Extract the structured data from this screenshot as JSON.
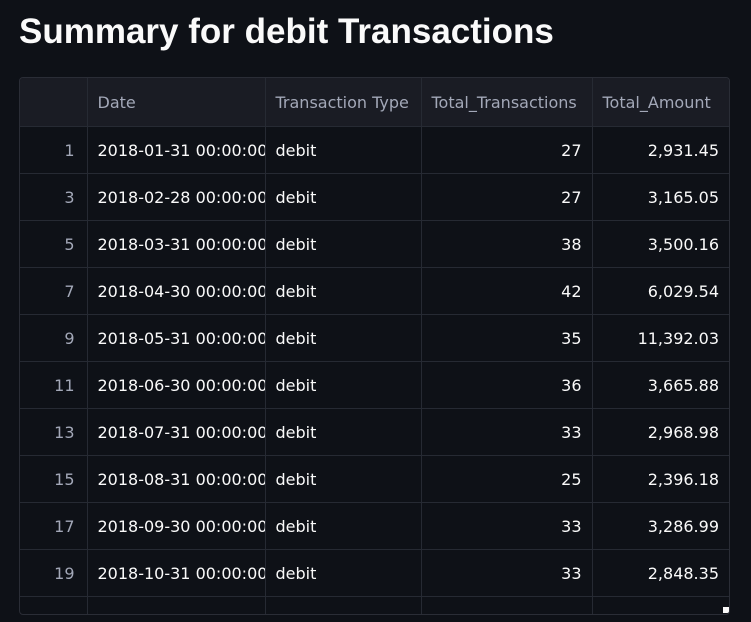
{
  "page": {
    "title": "Summary for debit Transactions"
  },
  "table": {
    "columns": [
      "",
      "Date",
      "Transaction Type",
      "Total_Transactions",
      "Total_Amount"
    ],
    "rows": [
      {
        "index": "1",
        "date": "2018-01-31 00:00:00",
        "type": "debit",
        "total_transactions": "27",
        "total_amount": "2,931.45"
      },
      {
        "index": "3",
        "date": "2018-02-28 00:00:00",
        "type": "debit",
        "total_transactions": "27",
        "total_amount": "3,165.05"
      },
      {
        "index": "5",
        "date": "2018-03-31 00:00:00",
        "type": "debit",
        "total_transactions": "38",
        "total_amount": "3,500.16"
      },
      {
        "index": "7",
        "date": "2018-04-30 00:00:00",
        "type": "debit",
        "total_transactions": "42",
        "total_amount": "6,029.54"
      },
      {
        "index": "9",
        "date": "2018-05-31 00:00:00",
        "type": "debit",
        "total_transactions": "35",
        "total_amount": "11,392.03"
      },
      {
        "index": "11",
        "date": "2018-06-30 00:00:00",
        "type": "debit",
        "total_transactions": "36",
        "total_amount": "3,665.88"
      },
      {
        "index": "13",
        "date": "2018-07-31 00:00:00",
        "type": "debit",
        "total_transactions": "33",
        "total_amount": "2,968.98"
      },
      {
        "index": "15",
        "date": "2018-08-31 00:00:00",
        "type": "debit",
        "total_transactions": "25",
        "total_amount": "2,396.18"
      },
      {
        "index": "17",
        "date": "2018-09-30 00:00:00",
        "type": "debit",
        "total_transactions": "33",
        "total_amount": "3,286.99"
      },
      {
        "index": "19",
        "date": "2018-10-31 00:00:00",
        "type": "debit",
        "total_transactions": "33",
        "total_amount": "2,848.35"
      }
    ]
  },
  "colors": {
    "background": "#0e1117",
    "header_background": "#1a1c24",
    "grid_line": "#262a33",
    "text": "#fafafa",
    "muted_text": "#a3a8b8"
  }
}
